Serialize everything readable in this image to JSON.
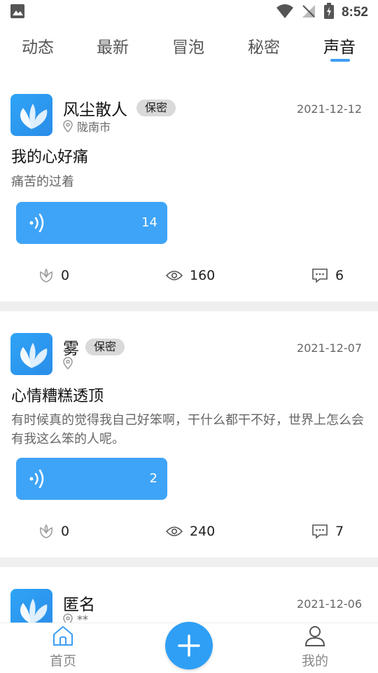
{
  "status_bar": {
    "time": "8:52",
    "icons": [
      "image-icon",
      "wifi-icon",
      "no-signal-icon",
      "battery-charging-icon"
    ]
  },
  "tabs": [
    {
      "label": "动态",
      "active": false
    },
    {
      "label": "最新",
      "active": false
    },
    {
      "label": "冒泡",
      "active": false
    },
    {
      "label": "秘密",
      "active": false
    },
    {
      "label": "声音",
      "active": true
    }
  ],
  "colors": {
    "accent": "#3e9df5",
    "voice_bg": "#3ea4f7",
    "badge_bg": "#d9d9d9",
    "divider": "#efefef"
  },
  "posts": [
    {
      "username": "风尘散人",
      "badge": "保密",
      "location": "陇南市",
      "date": "2021-12-12",
      "title": "我的心好痛",
      "desc": "痛苦的过着",
      "voice_count": "14",
      "likes": "0",
      "views": "160",
      "comments": "6"
    },
    {
      "username": "雾",
      "badge": "保密",
      "location": "",
      "date": "2021-12-07",
      "title": "心情糟糕透顶",
      "desc": "有时候真的觉得我自己好笨啊，干什么都干不好，世界上怎么会有我这么笨的人呢。",
      "voice_count": "2",
      "likes": "0",
      "views": "240",
      "comments": "7"
    },
    {
      "username": "匿名",
      "badge": "",
      "location": "**",
      "date": "2021-12-06"
    }
  ],
  "bottom_nav": {
    "home_label": "首页",
    "me_label": "我的"
  }
}
